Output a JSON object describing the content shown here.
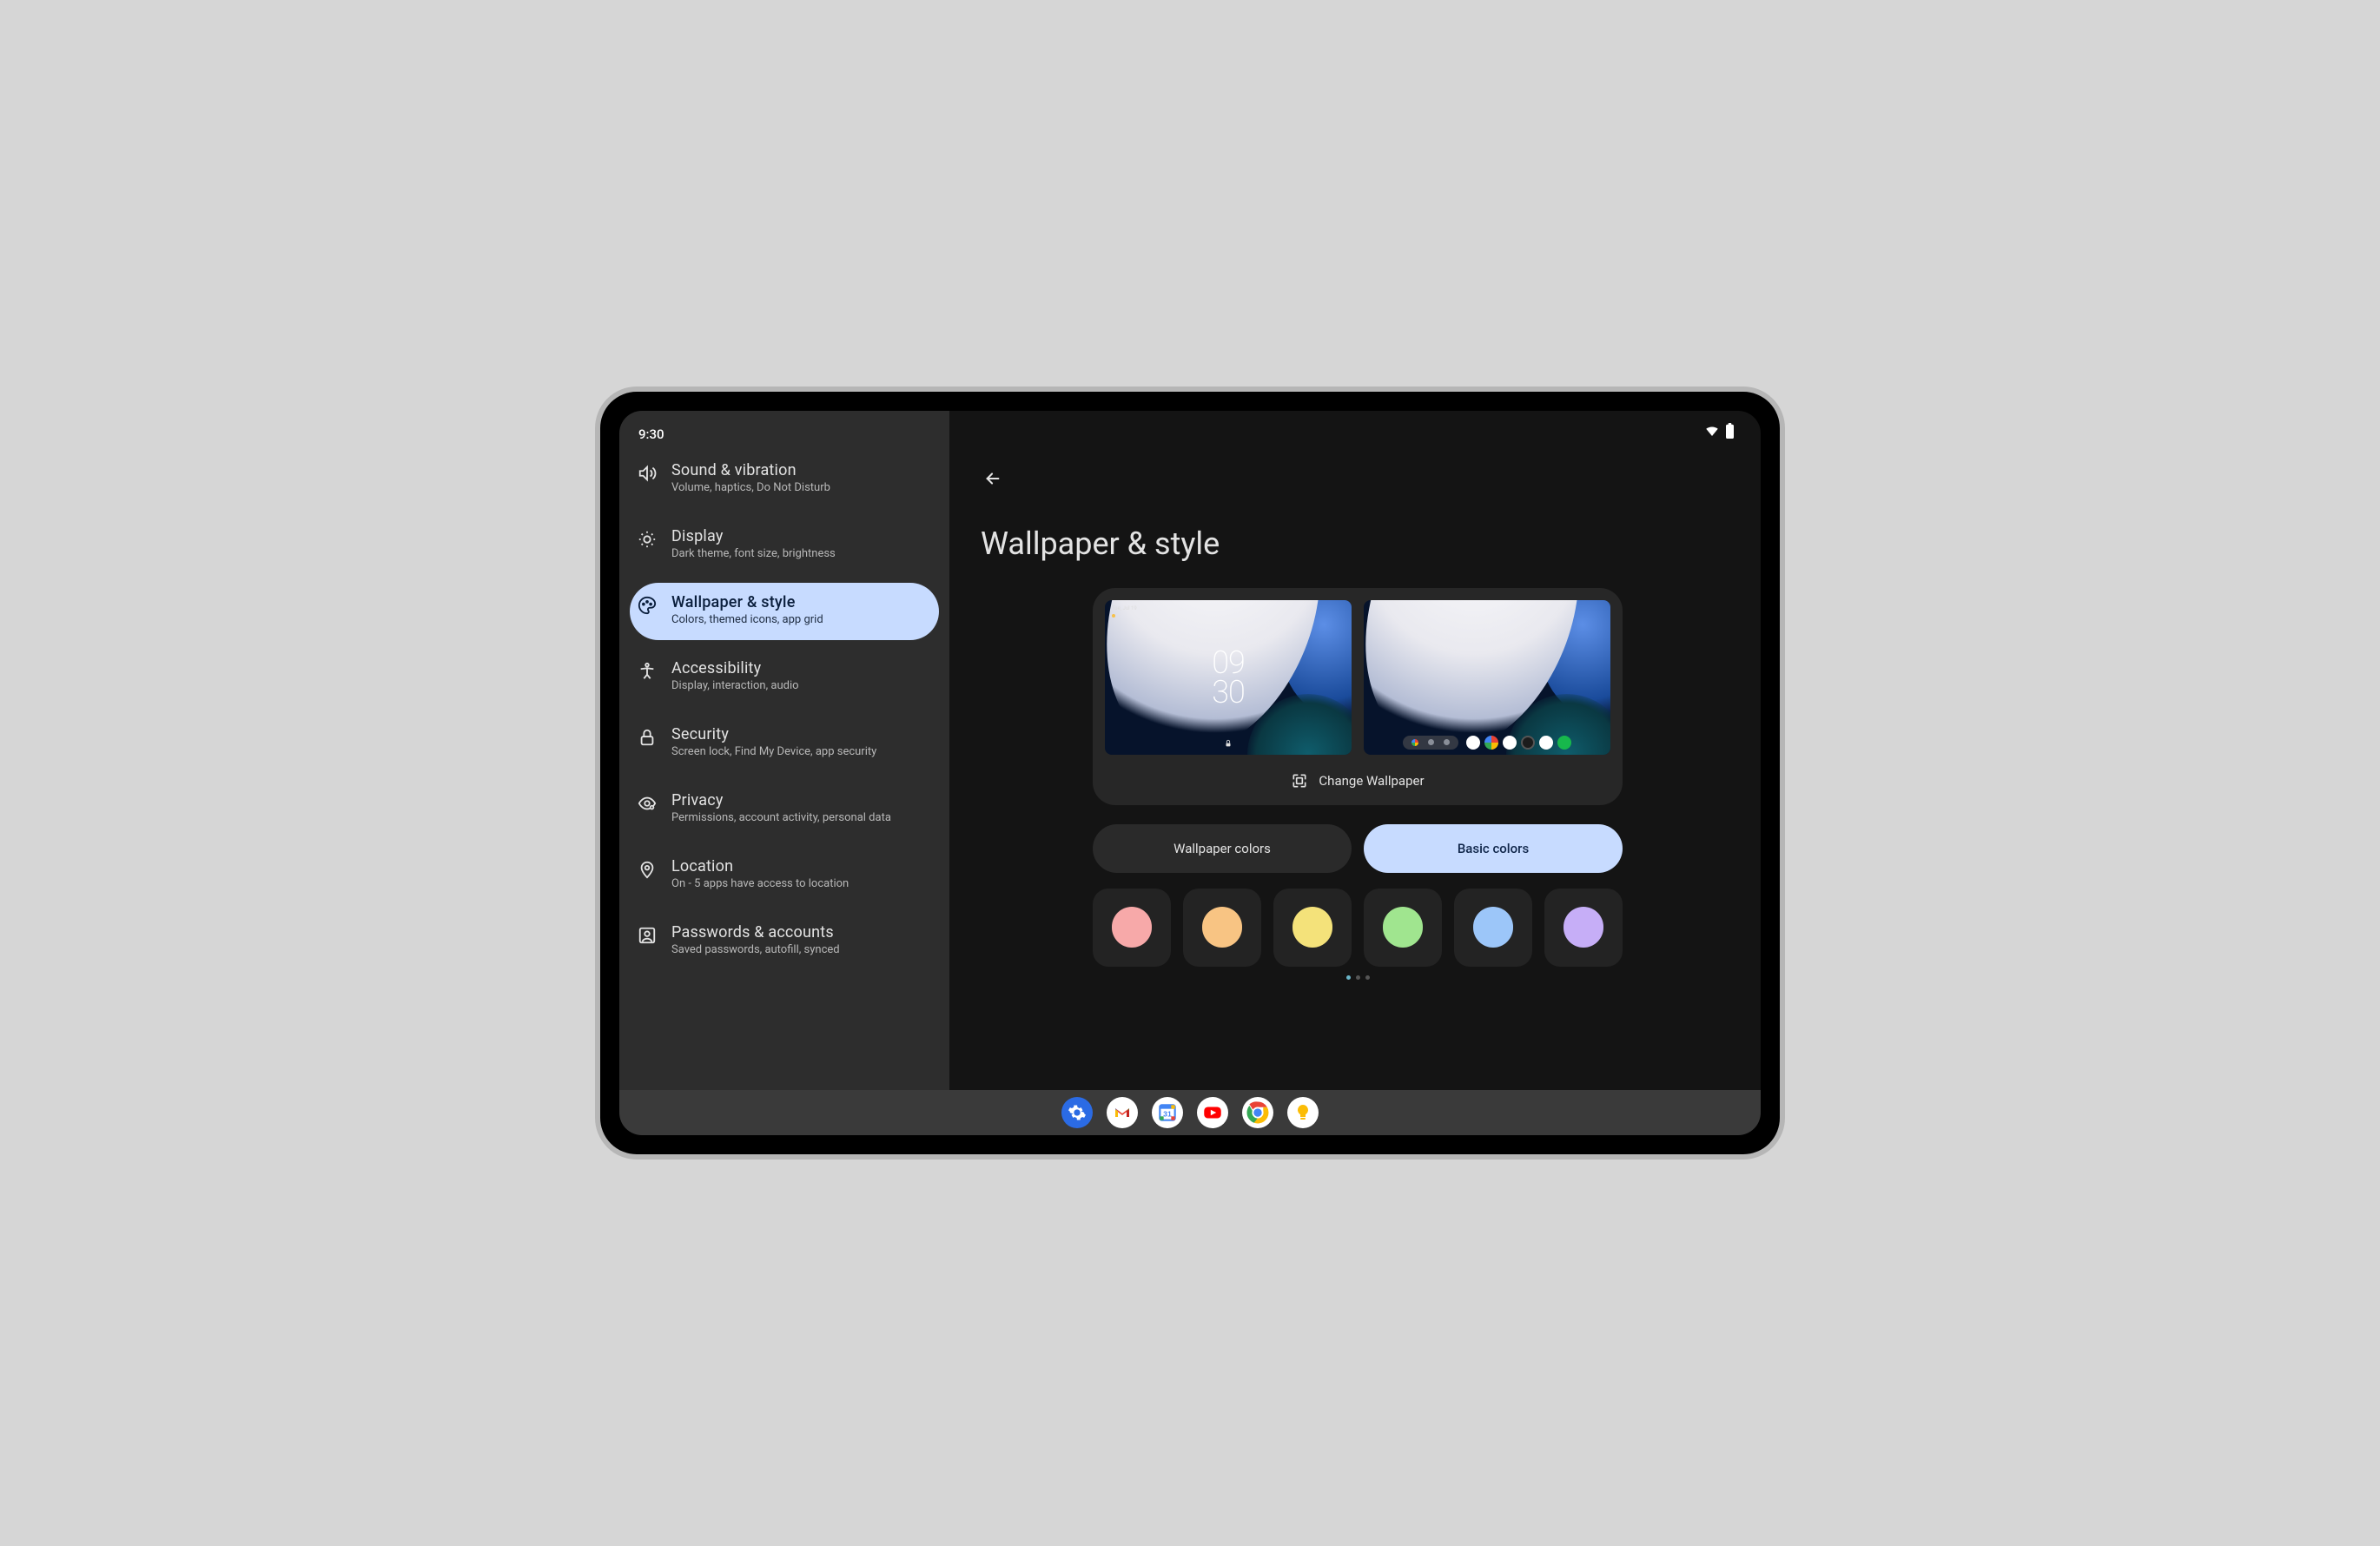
{
  "status": {
    "time": "9:30"
  },
  "sidebar": {
    "items": [
      {
        "title": "Sound & vibration",
        "sub": "Volume, haptics, Do Not Disturb"
      },
      {
        "title": "Display",
        "sub": "Dark theme, font size, brightness"
      },
      {
        "title": "Wallpaper & style",
        "sub": "Colors, themed icons, app grid"
      },
      {
        "title": "Accessibility",
        "sub": "Display, interaction, audio"
      },
      {
        "title": "Security",
        "sub": "Screen lock, Find My Device, app security"
      },
      {
        "title": "Privacy",
        "sub": "Permissions, account activity, personal data"
      },
      {
        "title": "Location",
        "sub": "On - 5 apps have access to location"
      },
      {
        "title": "Passwords & accounts",
        "sub": "Saved passwords, autofill, synced"
      }
    ],
    "selectedIndex": 2
  },
  "page": {
    "title": "Wallpaper & style",
    "changeWallpaperLabel": "Change Wallpaper",
    "lockPreview": {
      "timeTop": "09",
      "timeBottom": "30",
      "dateLabel": "Tue, Jul 19"
    },
    "tabs": {
      "wallpaperColors": "Wallpaper colors",
      "basicColors": "Basic colors",
      "active": "basicColors"
    },
    "swatches": [
      {
        "color": "#f7a9a9"
      },
      {
        "color": "#f8c483"
      },
      {
        "color": "#f4e27a"
      },
      {
        "color": "#a0e58f"
      },
      {
        "color": "#9cc6f9"
      },
      {
        "color": "#c6aef7"
      }
    ],
    "pagerDots": 3,
    "pagerActive": 0
  },
  "taskbar": {
    "apps": [
      "settings",
      "gmail",
      "calendar",
      "youtube",
      "chrome",
      "keep"
    ]
  }
}
